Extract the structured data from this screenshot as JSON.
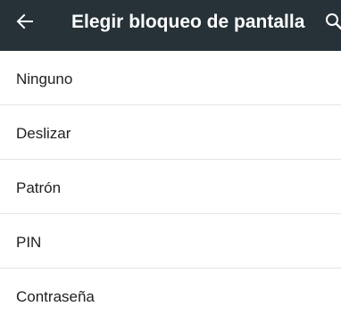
{
  "app_bar": {
    "title": "Elegir bloqueo de pantalla",
    "back_icon": "arrow-left-icon",
    "search_icon": "search-icon",
    "background_color": "#263238",
    "text_color": "#ffffff"
  },
  "lock_options": [
    {
      "label": "Ninguno"
    },
    {
      "label": "Deslizar"
    },
    {
      "label": "Patrón"
    },
    {
      "label": "PIN"
    },
    {
      "label": "Contraseña"
    }
  ]
}
